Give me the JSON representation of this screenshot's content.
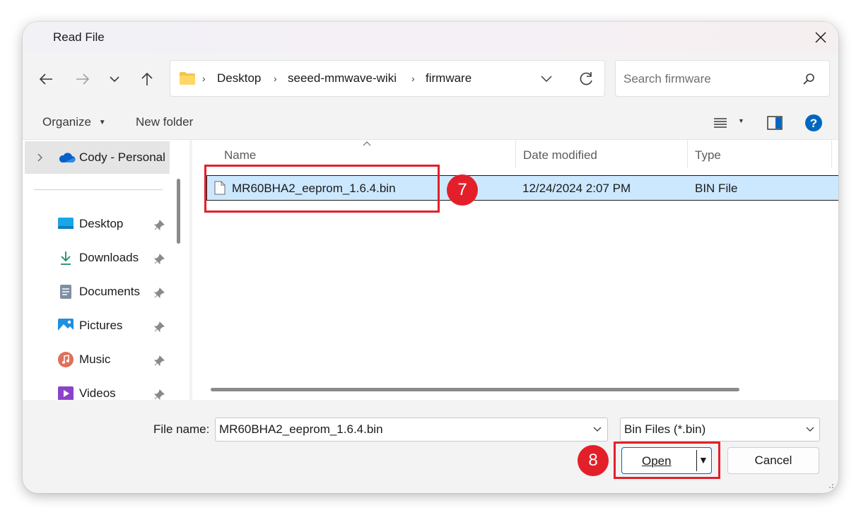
{
  "window": {
    "title": "Read File"
  },
  "breadcrumb": [
    "Desktop",
    "seeed-mmwave-wiki",
    "firmware"
  ],
  "search": {
    "placeholder": "Search firmware"
  },
  "toolbar": {
    "organize_label": "Organize",
    "new_folder_label": "New folder"
  },
  "navigation_pane": {
    "cloud_item": "Cody - Personal",
    "items": [
      {
        "label": "Desktop",
        "icon": "desktop-icon",
        "pinned": true
      },
      {
        "label": "Downloads",
        "icon": "download-icon",
        "pinned": true
      },
      {
        "label": "Documents",
        "icon": "documents-icon",
        "pinned": true
      },
      {
        "label": "Pictures",
        "icon": "pictures-icon",
        "pinned": true
      },
      {
        "label": "Music",
        "icon": "music-icon",
        "pinned": true
      },
      {
        "label": "Videos",
        "icon": "videos-icon",
        "pinned": true
      }
    ]
  },
  "file_list": {
    "columns": [
      "Name",
      "Date modified",
      "Type"
    ],
    "rows": [
      {
        "name": "MR60BHA2_eeprom_1.6.4.bin",
        "date_modified": "12/24/2024 2:07 PM",
        "type": "BIN File",
        "selected": true
      }
    ]
  },
  "footer": {
    "file_name_label": "File name:",
    "file_name_value": "MR60BHA2_eeprom_1.6.4.bin",
    "file_type_value": "Bin Files (*.bin)",
    "open_label": "Open",
    "cancel_label": "Cancel"
  },
  "annotations": {
    "step_file": "7",
    "step_open": "8"
  },
  "colors": {
    "accent": "#0067c0",
    "selection": "#cce8ff",
    "annotation": "#e3202a"
  }
}
